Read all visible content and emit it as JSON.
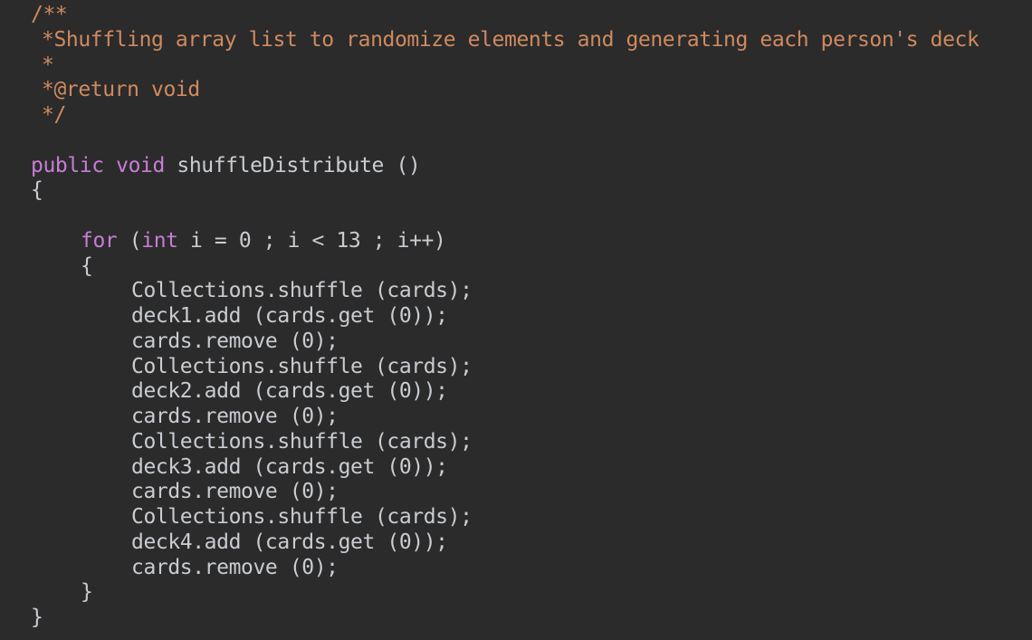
{
  "editor": {
    "background": "#2b2b2b",
    "colors": {
      "comment": "#d08a5f",
      "keyword": "#c77dd6",
      "text": "#c9ccd1"
    },
    "lines": [
      {
        "kind": "comment",
        "text": "/**"
      },
      {
        "kind": "comment",
        "text": "*Shuffling array list to randomize elements and generating each person's deck"
      },
      {
        "kind": "comment",
        "text": "*"
      },
      {
        "kind": "comment",
        "text": "*@return void"
      },
      {
        "kind": "comment",
        "text": "*/"
      },
      {
        "kind": "blank",
        "text": ""
      },
      {
        "kind": "signature",
        "modifier": "public",
        "type": "void",
        "name": "shuffleDistribute ()"
      },
      {
        "kind": "code",
        "text": "{"
      },
      {
        "kind": "blank",
        "text": ""
      },
      {
        "kind": "for",
        "keyword": "for",
        "open": "(",
        "type": "int",
        "rest": " i = 0 ; i < 13 ; i++)"
      },
      {
        "kind": "code",
        "text": "{"
      },
      {
        "kind": "code",
        "text": "Collections.shuffle (cards);"
      },
      {
        "kind": "code",
        "text": "deck1.add (cards.get (0));"
      },
      {
        "kind": "code",
        "text": "cards.remove (0);"
      },
      {
        "kind": "code",
        "text": "Collections.shuffle (cards);"
      },
      {
        "kind": "code",
        "text": "deck2.add (cards.get (0));"
      },
      {
        "kind": "code",
        "text": "cards.remove (0);"
      },
      {
        "kind": "code",
        "text": "Collections.shuffle (cards);"
      },
      {
        "kind": "code",
        "text": "deck3.add (cards.get (0));"
      },
      {
        "kind": "code",
        "text": "cards.remove (0);"
      },
      {
        "kind": "code",
        "text": "Collections.shuffle (cards);"
      },
      {
        "kind": "code",
        "text": "deck4.add (cards.get (0));"
      },
      {
        "kind": "code",
        "text": "cards.remove (0);"
      },
      {
        "kind": "code",
        "text": "}"
      },
      {
        "kind": "code",
        "text": "}"
      }
    ]
  }
}
